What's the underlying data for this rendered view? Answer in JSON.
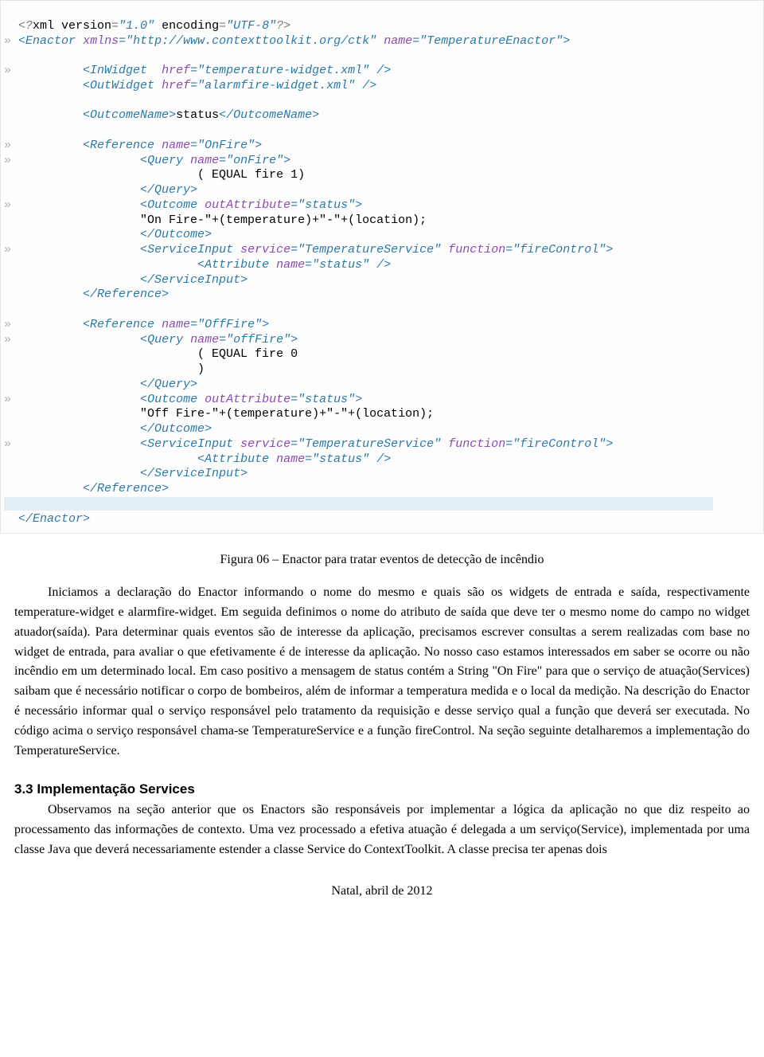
{
  "code": {
    "l01": "<?xml version=\"1.0\" encoding=\"UTF-8\"?>",
    "l02a_tag": "Enactor",
    "l02a_attr1": "xmlns",
    "l02a_val1": "http://www.contexttoolkit.org/ctk",
    "l02a_attr2": "name",
    "l02a_val2": "TemperatureEnactor",
    "l04_tag": "InWidget",
    "l04_attr": "href",
    "l04_val": "temperature-widget.xml",
    "l05_tag": "OutWidget",
    "l05_attr": "href",
    "l05_val": "alarmfire-widget.xml",
    "l07_tag": "OutcomeName",
    "l07_txt": "status",
    "l09_tag": "Reference",
    "l09_attr": "name",
    "l09_val": "OnFire",
    "l10_tag": "Query",
    "l10_attr": "name",
    "l10_val": "onFire",
    "l11_txt": "( EQUAL fire 1)",
    "l12_close": "Query",
    "l13_tag": "Outcome",
    "l13_attr": "outAttribute",
    "l13_val": "status",
    "l14_txt": "\"On Fire-\"+(temperature)+\"-\"+(location);",
    "l15_close": "Outcome",
    "l16_tag": "ServiceInput",
    "l16_attr1": "service",
    "l16_val1": "TemperatureService",
    "l16_attr2": "function",
    "l16_val2": "fireControl",
    "l17_tag": "Attribute",
    "l17_attr": "name",
    "l17_val": "status",
    "l18_close": "ServiceInput",
    "l19_close": "Reference",
    "l21_tag": "Reference",
    "l21_attr": "name",
    "l21_val": "OffFire",
    "l22_tag": "Query",
    "l22_attr": "name",
    "l22_val": "offFire",
    "l23_txt": "( EQUAL fire 0",
    "l24_txt": ")",
    "l25_close": "Query",
    "l26_tag": "Outcome",
    "l26_attr": "outAttribute",
    "l26_val": "status",
    "l27_txt": "\"Off Fire-\"+(temperature)+\"-\"+(location);",
    "l28_close": "Outcome",
    "l29_tag": "ServiceInput",
    "l29_attr1": "service",
    "l29_val1": "TemperatureService",
    "l29_attr2": "function",
    "l29_val2": "fireControl",
    "l30_tag": "Attribute",
    "l30_attr": "name",
    "l30_val": "status",
    "l31_close": "ServiceInput",
    "l32_close": "Reference",
    "l34_close": "Enactor"
  },
  "caption": "Figura 06 – Enactor para tratar eventos de detecção de incêndio",
  "para1": "Iniciamos a declaração do Enactor informando o nome do mesmo e quais são os widgets de entrada e saída, respectivamente temperature-widget e alarmfire-widget. Em seguida definimos o nome do atributo de saída que deve ter o mesmo nome do campo no widget atuador(saída). Para determinar quais eventos são de interesse da aplicação, precisamos escrever consultas a serem realizadas com base no widget de entrada, para avaliar o que efetivamente é de interesse da aplicação. No nosso caso estamos interessados em saber se ocorre ou não incêndio em um determinado local. Em caso positivo a mensagem de status contém a String \"On Fire\" para que o serviço de atuação(Services) saibam que é necessário notificar o corpo de bombeiros, além de informar a temperatura medida e o local da medição. Na descrição do Enactor é necessário informar qual o serviço responsável pelo tratamento da requisição e desse serviço qual a função que deverá ser executada. No código acima o serviço responsável chama-se TemperatureService e a função fireControl. Na seção seguinte detalharemos a implementação do TemperatureService.",
  "heading": "3.3 Implementação Services",
  "para2": "Observamos na seção anterior que os Enactors são responsáveis por implementar a lógica da aplicação no que diz respeito ao processamento das informações de contexto. Uma vez processado a efetiva atuação é delegada a um serviço(Service), implementada por uma classe Java que deverá necessariamente estender a classe Service do ContextToolkit. A classe precisa ter apenas dois",
  "footer": "Natal, abril de 2012",
  "marks": {
    "fold": "»"
  }
}
